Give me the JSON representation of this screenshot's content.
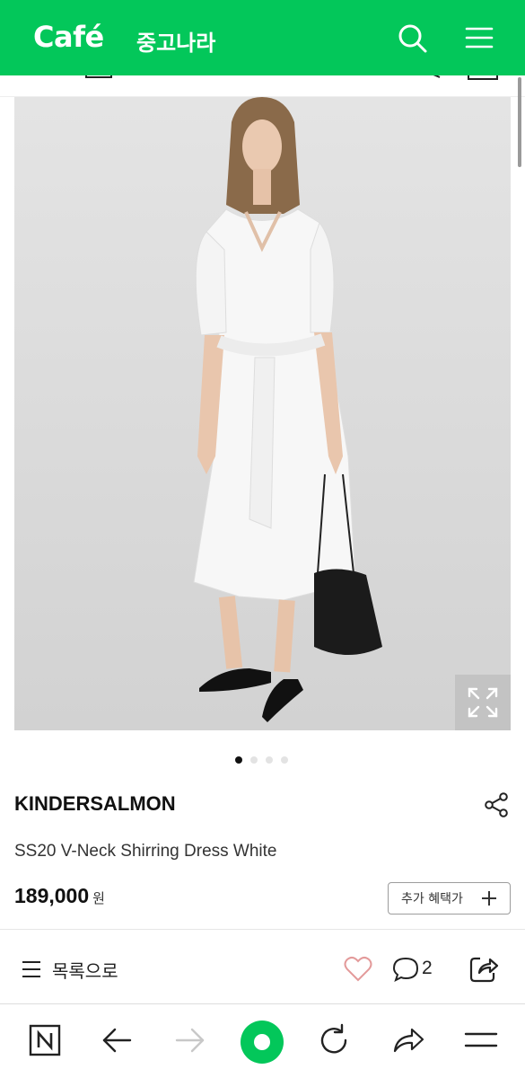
{
  "header": {
    "logo": "Café",
    "cafe_name": "중고나라",
    "icons": [
      "search-icon",
      "menu-icon"
    ],
    "brand_color": "#03c75a"
  },
  "product": {
    "image_count": 4,
    "active_image": 1,
    "brand": "KINDERSALMON",
    "title": "SS20 V-Neck Shirring Dress White",
    "price": "189,000",
    "price_unit": "원",
    "benefit_label": "추가 혜택가"
  },
  "actions": {
    "list_label": "목록으로",
    "comment_count": "2",
    "icons": [
      "list-icon",
      "heart-icon",
      "comment-icon",
      "share-icon"
    ]
  },
  "bottom_nav": {
    "icons": [
      "naver-icon",
      "back-arrow-icon",
      "forward-arrow-icon",
      "home-icon",
      "refresh-icon",
      "share-icon",
      "menu-icon"
    ]
  }
}
